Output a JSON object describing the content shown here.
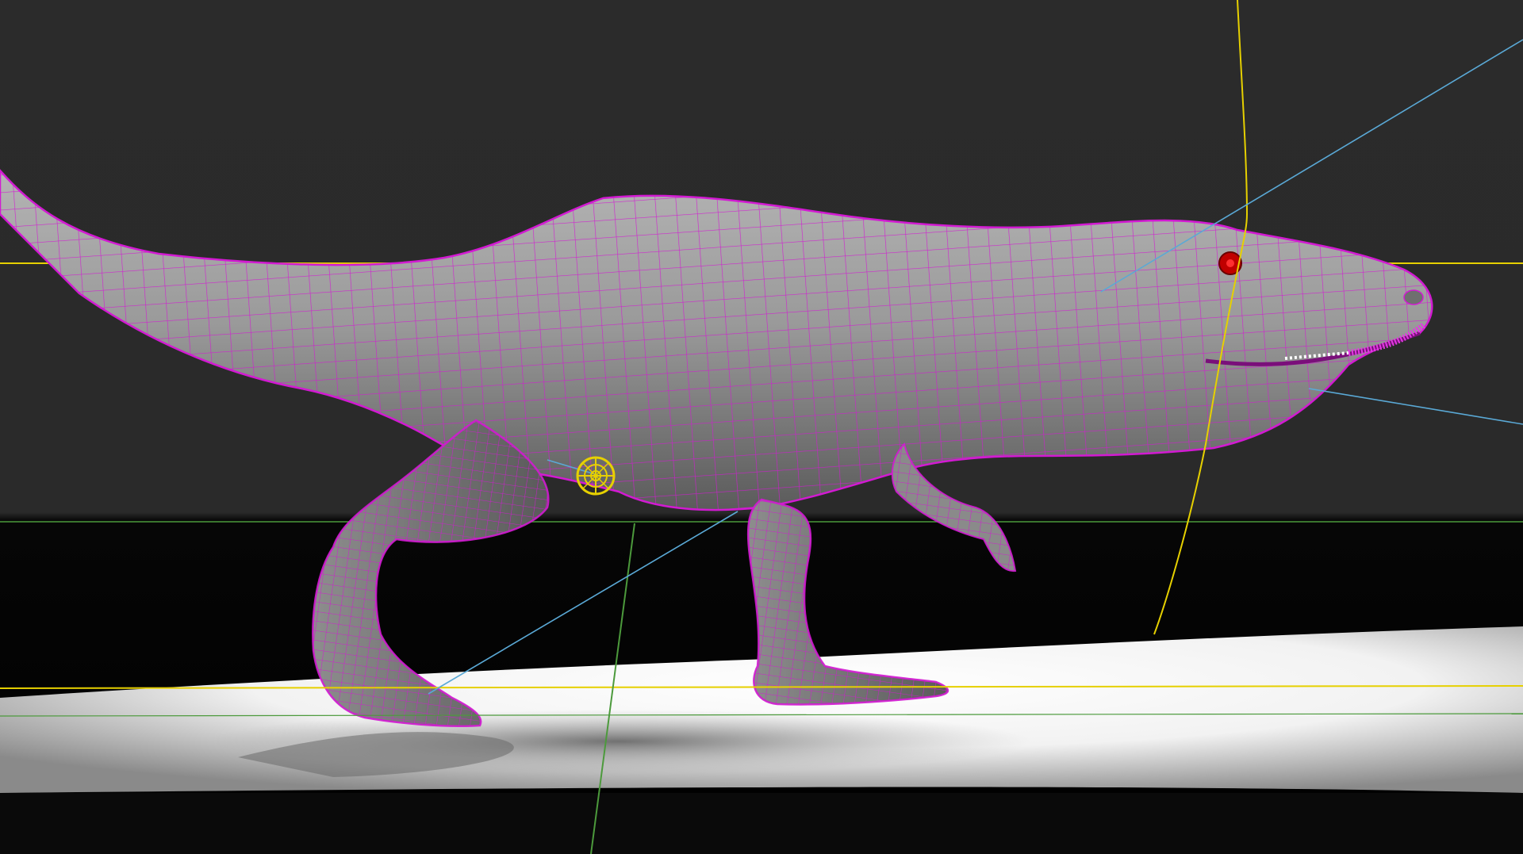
{
  "viewport": {
    "view": "3d-perspective-viewport",
    "display_mode": "smooth-shaded-with-wireframe-on-shaded",
    "subject": "t-rex-model",
    "colors": {
      "background_upper": "#2a2a2a",
      "background_lower": "#050505",
      "floor_light": "#ffffff",
      "mesh_shading": "#9a9a9a",
      "wireframe": "#d01ad0",
      "horizon_guides": "#e6d000",
      "world_axis_y": "#4c9a3c",
      "camera_axis": "#5aa9d6",
      "eye": "#c00000",
      "selection_locator": "#e6d000"
    }
  },
  "overlays": {
    "locator_icon": "crosshair-locator-icon",
    "eye_marker": "eye-marker"
  }
}
